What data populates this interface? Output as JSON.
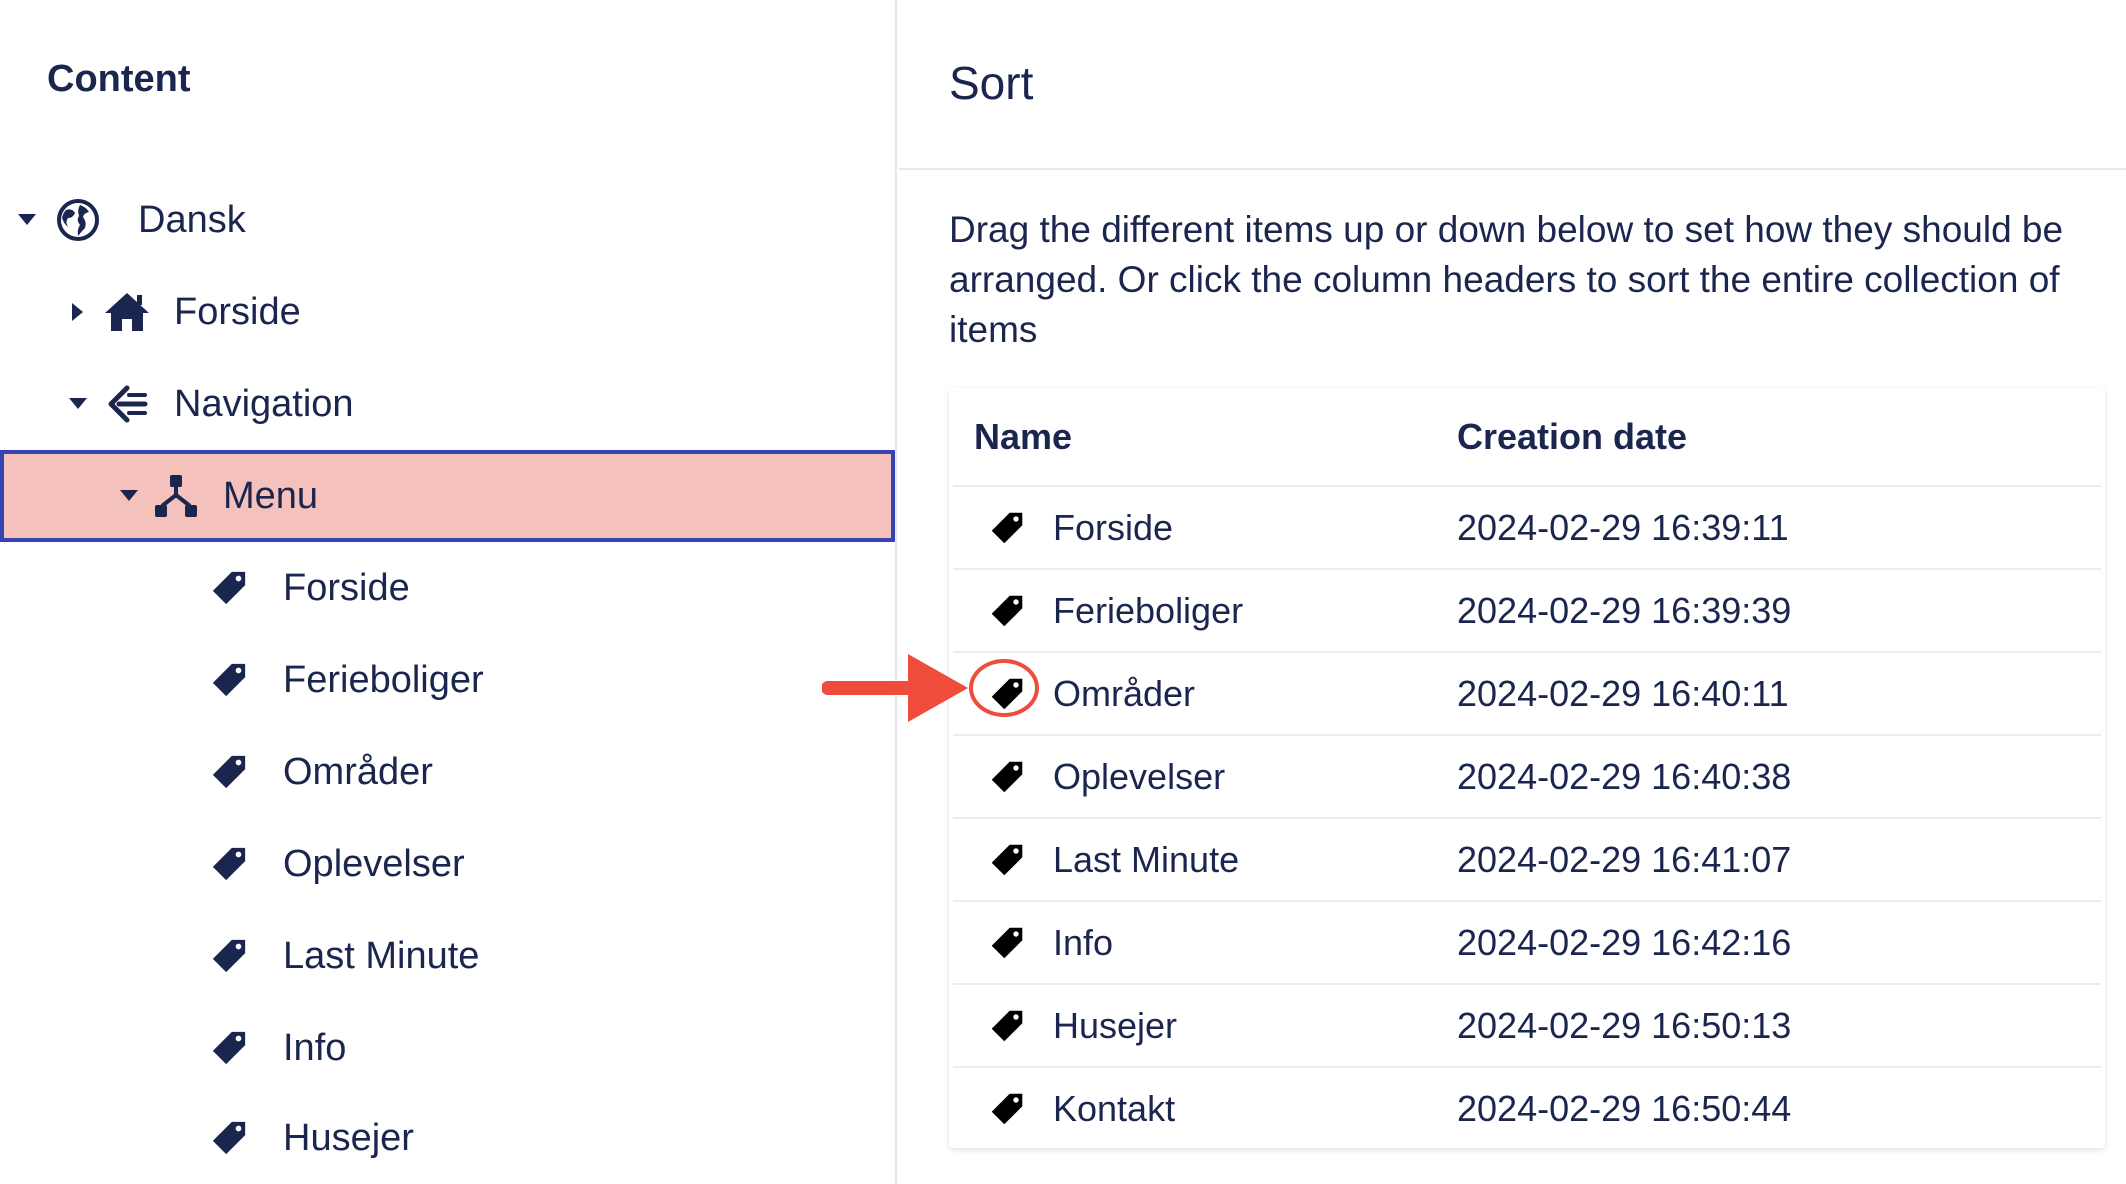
{
  "tree": {
    "title": "Content",
    "items": [
      {
        "label": "Dansk",
        "icon": "globe-icon",
        "caret": "down"
      },
      {
        "label": "Forside",
        "icon": "home-icon",
        "caret": "right"
      },
      {
        "label": "Navigation",
        "icon": "navigation-icon",
        "caret": "down"
      },
      {
        "label": "Menu",
        "icon": "sitemap-icon",
        "caret": "down",
        "selected": true
      },
      {
        "label": "Forside",
        "icon": "tag-icon"
      },
      {
        "label": "Ferieboliger",
        "icon": "tag-icon"
      },
      {
        "label": "Områder",
        "icon": "tag-icon"
      },
      {
        "label": "Oplevelser",
        "icon": "tag-icon"
      },
      {
        "label": "Last Minute",
        "icon": "tag-icon"
      },
      {
        "label": "Info",
        "icon": "tag-icon"
      },
      {
        "label": "Husejer",
        "icon": "tag-icon"
      }
    ]
  },
  "sort": {
    "title": "Sort",
    "description": "Drag the different items up or down below to set how they should be arranged. Or click the column headers to sort the entire collection of items",
    "columns": {
      "name": "Name",
      "date": "Creation date"
    },
    "rows": [
      {
        "name": "Forside",
        "date": "2024-02-29 16:39:11"
      },
      {
        "name": "Ferieboliger",
        "date": "2024-02-29 16:39:39"
      },
      {
        "name": "Områder",
        "date": "2024-02-29 16:40:11"
      },
      {
        "name": "Oplevelser",
        "date": "2024-02-29 16:40:38"
      },
      {
        "name": "Last Minute",
        "date": "2024-02-29 16:41:07"
      },
      {
        "name": "Info",
        "date": "2024-02-29 16:42:16"
      },
      {
        "name": "Husejer",
        "date": "2024-02-29 16:50:13"
      },
      {
        "name": "Kontakt",
        "date": "2024-02-29 16:50:44"
      }
    ]
  },
  "colors": {
    "text": "#1b264f",
    "selected_bg": "#f5c1bc",
    "selected_border": "#3544b1",
    "annotation": "#ef4c3b"
  }
}
